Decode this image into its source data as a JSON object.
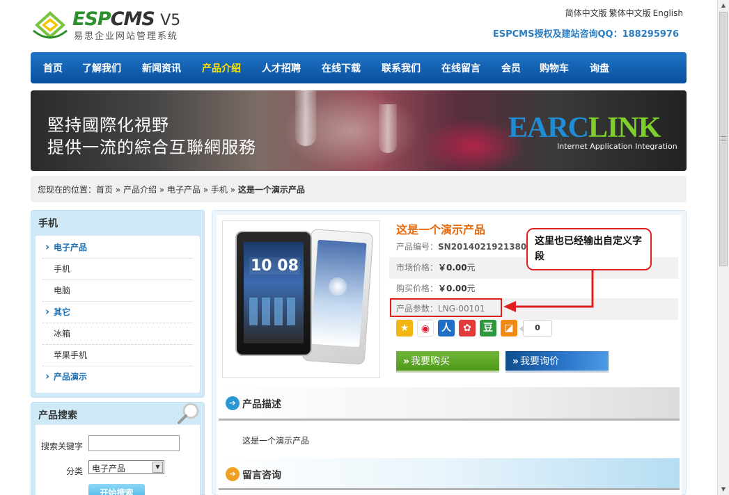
{
  "header": {
    "brand_esp": "ESP",
    "brand_cms": "CMS",
    "brand_v5": "V5",
    "brand_sub": "易思企业网站管理系统",
    "languages": [
      "简体中文版",
      "繁体中文版",
      "English"
    ],
    "hotline": "ESPCMS授权及建站咨询QQ：188295976"
  },
  "nav": {
    "items": [
      "首页",
      "了解我们",
      "新闻资讯",
      "产品介绍",
      "人才招聘",
      "在线下载",
      "联系我们",
      "在线留言",
      "会员",
      "购物车",
      "询盘"
    ],
    "active_index": 3
  },
  "banner": {
    "line1": "堅持國際化視野",
    "line2": "提供一流的綜合互聯網服務",
    "brand_blue": "EARC",
    "brand_green": "LINK",
    "tagline": "Internet Application Integration"
  },
  "breadcrumb": {
    "prefix": "您现在的位置：",
    "path": "首页 » 产品介绍 » 电子产品 » 手机 » ",
    "current": "这是一个演示产品"
  },
  "sidebar": {
    "title": "手机",
    "categories": [
      {
        "label": "电子产品",
        "level": 1
      },
      {
        "label": "手机",
        "level": 2
      },
      {
        "label": "电脑",
        "level": 2
      },
      {
        "label": "其它",
        "level": 1
      },
      {
        "label": "冰箱",
        "level": 2
      },
      {
        "label": "苹果手机",
        "level": 2
      },
      {
        "label": "产品演示",
        "level": 1
      }
    ]
  },
  "search": {
    "title": "产品搜索",
    "keyword_label": "搜索关键字",
    "keyword_value": "",
    "category_label": "分类",
    "category_selected": "电子产品",
    "submit_label": "开始搜索"
  },
  "product": {
    "name": "这是一个演示产品",
    "sn_label": "产品编号：",
    "sn_value": "SN20140219213800690",
    "market_label": "市场价格：",
    "market_value": "￥0.00",
    "buy_label": "购买价格：",
    "buy_value": "￥0.00",
    "yuan": "元",
    "param_label": "产品参数：",
    "param_value": "LNG-00101",
    "tablet_clock": "10 08",
    "share_count": "0",
    "share_icons": [
      "qzone-icon",
      "weibo-icon",
      "renren-icon",
      "kaixin-icon",
      "douban-icon",
      "qqweibo-icon"
    ],
    "buy_button": "我要购买",
    "inquiry_button": "我要询价"
  },
  "sections": {
    "desc_title": "产品描述",
    "desc_text": "这是一个演示产品",
    "message_title": "留言咨询"
  },
  "annotation": {
    "callout_text": "这里也已经输出自定义字段"
  },
  "colors": {
    "nav_bg": "#0a4f9f",
    "nav_active": "#ffe400",
    "title_orange": "#e46b0d",
    "annotation_red": "#e02020",
    "buy_green": "#4d9a18",
    "inquiry_blue": "#2b75c9"
  }
}
